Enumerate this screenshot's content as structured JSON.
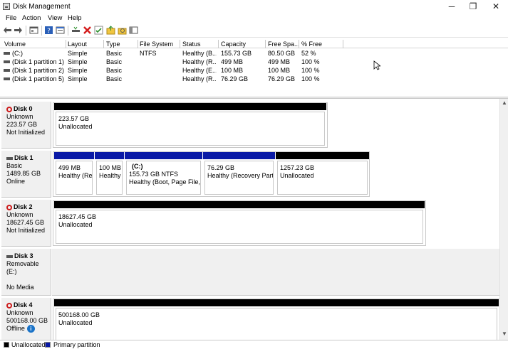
{
  "window": {
    "title": "Disk Management",
    "minimize": "─",
    "restore": "❐",
    "close": "✕"
  },
  "menu": [
    "File",
    "Action",
    "View",
    "Help"
  ],
  "volume_table": {
    "columns": [
      "Volume",
      "Layout",
      "Type",
      "File System",
      "Status",
      "Capacity",
      "Free Spa...",
      "% Free"
    ],
    "rows": [
      [
        "(C:)",
        "Simple",
        "Basic",
        "NTFS",
        "Healthy (B...",
        "155.73 GB",
        "80.50 GB",
        "52 %"
      ],
      [
        "(Disk 1 partition 1)",
        "Simple",
        "Basic",
        "",
        "Healthy (R...",
        "499 MB",
        "499 MB",
        "100 %"
      ],
      [
        "(Disk 1 partition 2)",
        "Simple",
        "Basic",
        "",
        "Healthy (E...",
        "100 MB",
        "100 MB",
        "100 %"
      ],
      [
        "(Disk 1 partition 5)",
        "Simple",
        "Basic",
        "",
        "Healthy (R...",
        "76.29 GB",
        "76.29 GB",
        "100 %"
      ]
    ]
  },
  "disks": [
    {
      "name": "Disk 0",
      "line1": "Unknown",
      "line2": "223.57 GB",
      "line3": "Not Initialized",
      "partitions": [
        {
          "size": "223.57 GB",
          "status": "Unallocated"
        }
      ]
    },
    {
      "name": "Disk 1",
      "line1": "Basic",
      "line2": "1489.85 GB",
      "line3": "Online",
      "partitions": [
        {
          "label": "",
          "size": "499 MB",
          "status": "Healthy (Rec"
        },
        {
          "label": "",
          "size": "100 MB",
          "status": "Healthy"
        },
        {
          "label": "(C:)",
          "size": "155.73 GB NTFS",
          "status": "Healthy (Boot, Page File, Cr"
        },
        {
          "label": "",
          "size": "76.29 GB",
          "status": "Healthy (Recovery Partitio"
        },
        {
          "label": "",
          "size": "1257.23 GB",
          "status": "Unallocated"
        }
      ]
    },
    {
      "name": "Disk 2",
      "line1": "Unknown",
      "line2": "18627.45 GB",
      "line3": "Not Initialized",
      "partitions": [
        {
          "size": "18627.45 GB",
          "status": "Unallocated"
        }
      ]
    },
    {
      "name": "Disk 3",
      "line1": "Removable (E:)",
      "line2": "",
      "line3": "No Media",
      "partitions": []
    },
    {
      "name": "Disk 4",
      "line1": "Unknown",
      "line2": "500168.00 GB",
      "line3": "Offline",
      "info": "i",
      "partitions": [
        {
          "size": "500168.00 GB",
          "status": "Unallocated"
        }
      ]
    }
  ],
  "legend": [
    {
      "label": "Unallocated",
      "color": "#000000"
    },
    {
      "label": "Primary partition",
      "color": "#0a1aa6"
    }
  ],
  "scroll": {
    "up": "▲",
    "down": "▼"
  }
}
